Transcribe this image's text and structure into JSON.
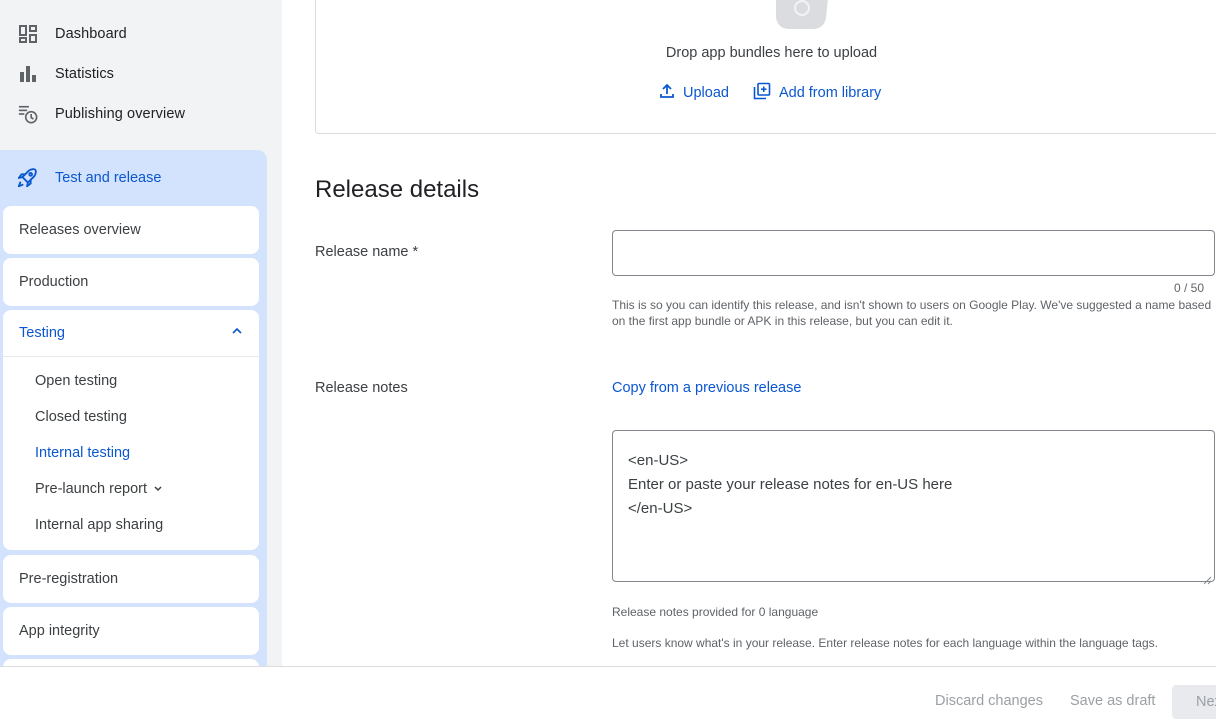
{
  "sidebar": {
    "top_items": [
      {
        "label": "Dashboard",
        "icon": "dashboard-icon"
      },
      {
        "label": "Statistics",
        "icon": "bar-chart-icon"
      },
      {
        "label": "Publishing overview",
        "icon": "schedule-list-icon"
      }
    ],
    "section": {
      "label": "Test and release",
      "icon": "rocket-icon"
    },
    "cards": {
      "releases_overview": "Releases overview",
      "production": "Production",
      "testing": "Testing",
      "pre_registration": "Pre-registration",
      "app_integrity": "App integrity"
    },
    "testing_items": [
      {
        "label": "Open testing"
      },
      {
        "label": "Closed testing"
      },
      {
        "label": "Internal testing",
        "active": true
      },
      {
        "label": "Pre-launch report"
      },
      {
        "label": "Internal app sharing"
      }
    ]
  },
  "upload": {
    "drop_text": "Drop app bundles here to upload",
    "upload_label": "Upload",
    "library_label": "Add from library"
  },
  "release_details": {
    "title": "Release details",
    "name_label": "Release name",
    "required_mark": "*",
    "name_value": "",
    "name_counter": "0 / 50",
    "name_help": "This is so you can identify this release, and isn't shown to users on Google Play. We've suggested a name based on the first app bundle or APK in this release, but you can edit it.",
    "notes_label": "Release notes",
    "copy_link": "Copy from a previous release",
    "notes_lines": [
      "<en-US>",
      "Enter or paste your release notes for en-US here",
      "</en-US>"
    ],
    "notes_count": "Release notes provided for 0 language",
    "notes_help": "Let users know what's in your release. Enter release notes for each language within the language tags."
  },
  "footer": {
    "discard": "Discard changes",
    "save_draft": "Save as draft",
    "next": "Next"
  },
  "colors": {
    "accent": "#0b57d0",
    "section_bg": "#d3e3fd",
    "sidebar_bg": "#f1f3f4"
  }
}
